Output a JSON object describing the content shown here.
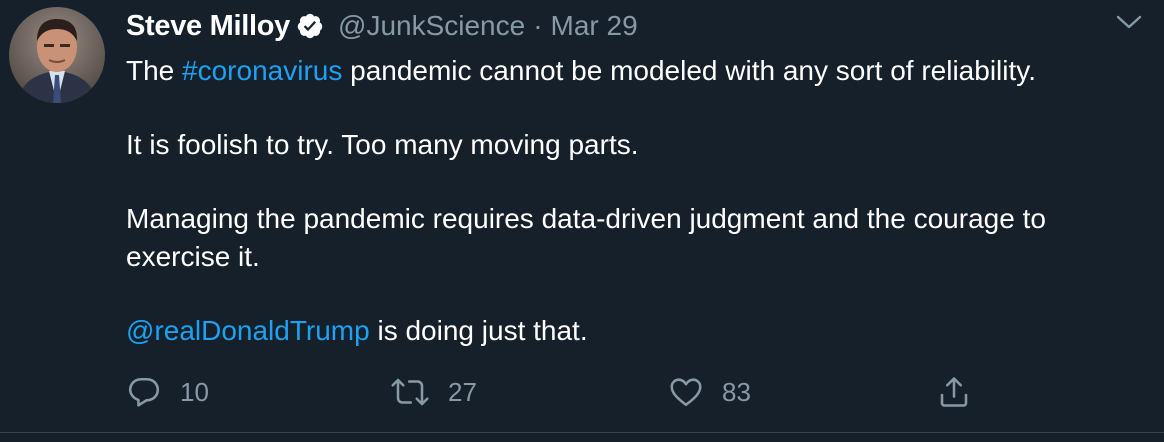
{
  "tweet": {
    "author_name": "Steve Milloy",
    "handle": "@JunkScience",
    "separator": "·",
    "date": "Mar 29",
    "verified_icon": "verified-badge-icon",
    "paragraphs": [
      {
        "parts": [
          {
            "text": "The ",
            "link": false
          },
          {
            "text": "#coronavirus",
            "link": true
          },
          {
            "text": " pandemic cannot be modeled with any sort of reliability.",
            "link": false
          }
        ]
      },
      {
        "parts": [
          {
            "text": "It is foolish to try. Too many moving parts.",
            "link": false
          }
        ]
      },
      {
        "parts": [
          {
            "text": "Managing the pandemic requires data-driven judgment and the courage to exercise it.",
            "link": false
          }
        ]
      },
      {
        "parts": [
          {
            "text": "@realDonaldTrump",
            "link": true
          },
          {
            "text": " is doing just that.",
            "link": false
          }
        ]
      }
    ],
    "actions": {
      "reply_count": "10",
      "retweet_count": "27",
      "like_count": "83"
    }
  },
  "colors": {
    "background": "#15202b",
    "text": "#ffffff",
    "muted": "#8899a6",
    "link": "#1da1f2"
  }
}
